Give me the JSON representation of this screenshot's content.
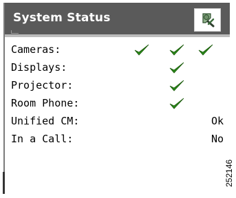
{
  "panel": {
    "title": "System Status",
    "header_icon": "tools-icon"
  },
  "status_rows": [
    {
      "label": "Cameras:",
      "checks": 3
    },
    {
      "label": "Displays:",
      "checks": 1
    },
    {
      "label": "Projector:",
      "checks": 1
    },
    {
      "label": "Room Phone:",
      "checks": 1
    },
    {
      "label": "Unified CM:",
      "value": "Ok"
    },
    {
      "label": "In a Call:",
      "value": "No"
    }
  ],
  "figure_id": "252146",
  "colors": {
    "header": "#5a5a5a",
    "check": "#2a8a1a"
  }
}
